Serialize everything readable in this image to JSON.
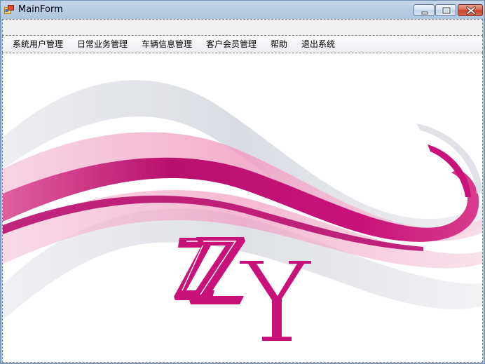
{
  "window": {
    "title": "MainForm",
    "icon": "app-window-icon",
    "controls": [
      "minimize-icon",
      "maximize-icon",
      "close-icon"
    ]
  },
  "menu": {
    "items": [
      {
        "label": "系统用户管理"
      },
      {
        "label": "日常业务管理"
      },
      {
        "label": "车辆信息管理"
      },
      {
        "label": "客户会员管理"
      },
      {
        "label": "帮助"
      },
      {
        "label": "退出系统"
      }
    ]
  },
  "background": {
    "logo_text": "ZZY",
    "accent_color": "#c8127a",
    "accent_light": "#f2a6c6",
    "wave_grey": "#d8dbe2"
  }
}
